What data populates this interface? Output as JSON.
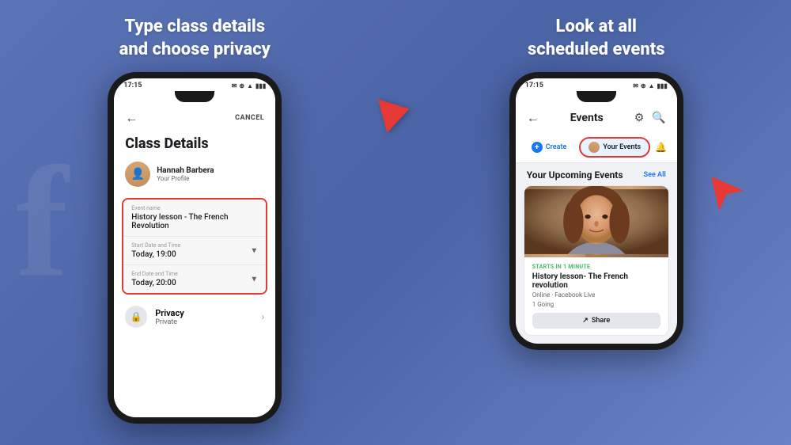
{
  "panel1": {
    "title": "Type class details\nand choose privacy",
    "phone": {
      "status_time": "17:15",
      "nav_cancel": "CANCEL",
      "screen_title": "Class Details",
      "profile_name": "Hannah Barbera",
      "profile_sub": "Your Profile",
      "form": {
        "event_name_label": "Event name",
        "event_name_value": "History lesson - The French Revolution",
        "start_date_label": "Start Date and Time",
        "start_date_value": "Today, 19:00",
        "end_date_label": "End Date and Time",
        "end_date_value": "Today, 20:00"
      },
      "privacy_label": "Privacy",
      "privacy_value": "Private"
    }
  },
  "panel2": {
    "title": "Look at all\nscheduled events",
    "phone": {
      "status_time": "17:15",
      "nav_title": "Events",
      "tab_create": "Create",
      "tab_your_events": "Your Events",
      "upcoming_title": "Your Upcoming Events",
      "see_all": "See All",
      "event": {
        "starts_in": "STARTS IN 1 MINUTE",
        "name": "History lesson- The French revolution",
        "meta": "Online · Facebook Live",
        "going": "1 Going",
        "share_btn": "Share"
      }
    }
  }
}
